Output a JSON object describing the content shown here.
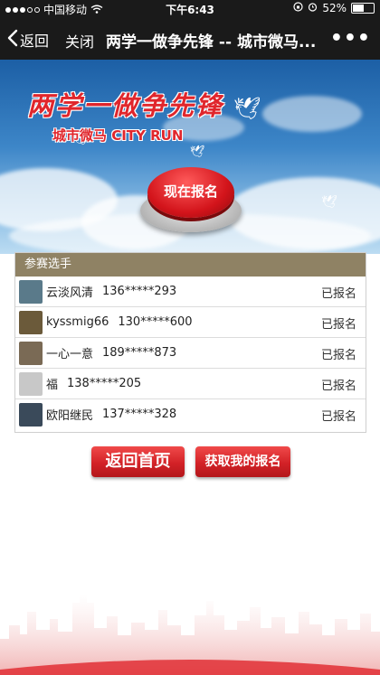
{
  "status_bar": {
    "carrier": "中国移动",
    "time": "下午6:43",
    "battery_percent": "52%",
    "battery_level": 0.52
  },
  "nav": {
    "back_label": "返回",
    "close_label": "关闭",
    "title": "两学一做争先锋 -- 城市微马...",
    "more_label": "•••"
  },
  "banner": {
    "title": "两学一做争先锋",
    "subtitle": "城市微马 CITY RUN",
    "register_button": "现在报名"
  },
  "participants": {
    "header": "参赛选手",
    "rows": [
      {
        "name": "云淡风清",
        "phone": "136*****293",
        "status": "已报名",
        "avatar_color": "#5a7a8a"
      },
      {
        "name": "kyssmig66",
        "phone": "130*****600",
        "status": "已报名",
        "avatar_color": "#6b5a3a"
      },
      {
        "name": "一心一意",
        "phone": "189*****873",
        "status": "已报名",
        "avatar_color": "#7a6a55"
      },
      {
        "name": "福",
        "phone": "138*****205",
        "status": "已报名",
        "avatar_color": "#c8c8c8"
      },
      {
        "name": "欧阳继民",
        "phone": "137*****328",
        "status": "已报名",
        "avatar_color": "#3a4a5a"
      }
    ]
  },
  "buttons": {
    "home": "返回首页",
    "my_registration": "获取我的报名"
  },
  "colors": {
    "panel_header": "#8f8264",
    "accent_red": "#d32227"
  }
}
